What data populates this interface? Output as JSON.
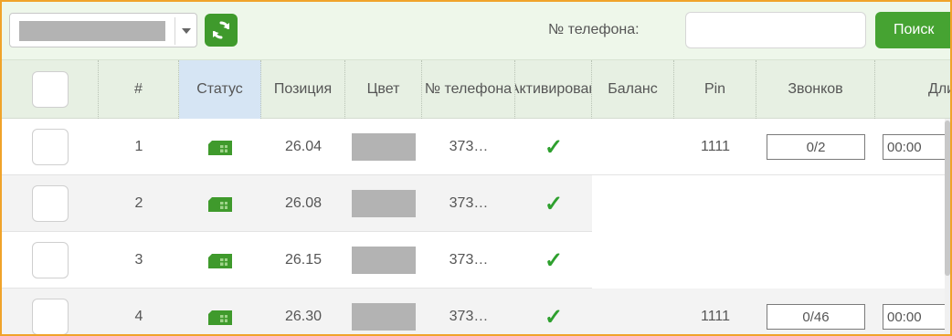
{
  "toolbar": {
    "phone_label": "№ телефона:",
    "phone_value": "",
    "search_label": "Поиск"
  },
  "columns": [
    "#",
    "Статус",
    "Позиция",
    "Цвет",
    "№ телефона",
    "Активирован",
    "Баланс",
    "Pin",
    "Звонков",
    "Длит"
  ],
  "rows": [
    {
      "num": "1",
      "position": "26.04",
      "phone": "373…",
      "activated": true,
      "balance": "",
      "pin": "1111",
      "calls": "0/2",
      "duration": "00:00"
    },
    {
      "num": "2",
      "position": "26.08",
      "phone": "373…",
      "activated": true,
      "balance": "",
      "pin": "",
      "calls": "",
      "duration": ""
    },
    {
      "num": "3",
      "position": "26.15",
      "phone": "373…",
      "activated": true,
      "balance": "",
      "pin": "",
      "calls": "",
      "duration": ""
    },
    {
      "num": "4",
      "position": "26.30",
      "phone": "373…",
      "activated": true,
      "balance": "",
      "pin": "1111",
      "calls": "0/46",
      "duration": "00:00"
    }
  ],
  "colors": {
    "accent_green": "#46a332",
    "status_icon": "#3f9a2c",
    "check": "#2ea02e",
    "frame_border": "#f0a32a"
  },
  "icons": {
    "refresh": "refresh-icon",
    "status": "sim-card-icon",
    "activated": "checkmark-icon"
  }
}
